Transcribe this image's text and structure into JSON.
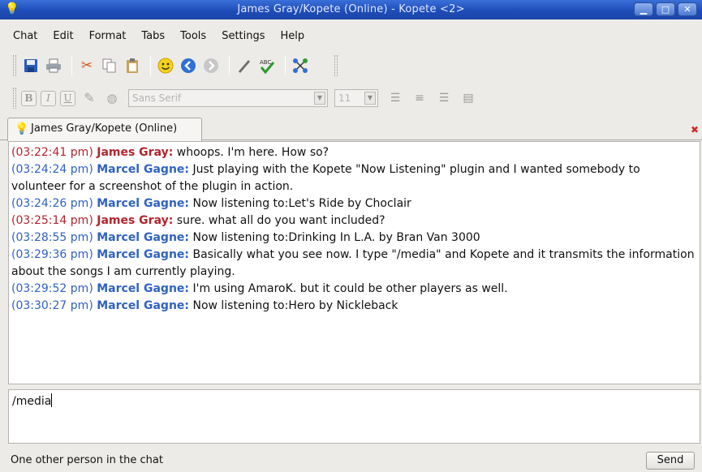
{
  "window": {
    "title": "James Gray/Kopete (Online) - Kopete <2>",
    "app_icon": "lightbulb-icon",
    "controls": [
      "minimize-icon",
      "maximize-icon",
      "close-icon"
    ]
  },
  "menu": [
    "Chat",
    "Edit",
    "Format",
    "Tabs",
    "Tools",
    "Settings",
    "Help"
  ],
  "toolbar": {
    "icons": [
      "save-icon",
      "print-icon",
      "cut-icon",
      "copy-icon",
      "paste-icon",
      "smiley-icon",
      "back-icon",
      "forward-icon",
      "pencil-icon",
      "spellcheck-icon",
      "contacts-icon"
    ]
  },
  "format_toolbar": {
    "bold": "B",
    "italic": "I",
    "underline": "U",
    "font": "Sans Serif",
    "size": "11"
  },
  "tab": {
    "label": "James Gray/Kopete (Online)"
  },
  "messages": [
    {
      "ts": "(03:22:41 pm)",
      "nick": "James Gray:",
      "text": "whoops. I'm here.  How so?",
      "sender": "them"
    },
    {
      "ts": "(03:24:24 pm)",
      "nick": "Marcel Gagne:",
      "text": "Just playing with the Kopete \"Now Listening\" plugin and I wanted somebody to volunteer for a screenshot of the plugin in action.",
      "sender": "me"
    },
    {
      "ts": "(03:24:26 pm)",
      "nick": "Marcel Gagne:",
      "text": "Now listening to:Let's Ride by Choclair",
      "sender": "me"
    },
    {
      "ts": "(03:25:14 pm)",
      "nick": "James Gray:",
      "text": "sure. what all do you want included?",
      "sender": "them"
    },
    {
      "ts": "(03:28:55 pm)",
      "nick": "Marcel Gagne:",
      "text": "Now listening to:Drinking In L.A. by Bran Van 3000",
      "sender": "me"
    },
    {
      "ts": "(03:29:36 pm)",
      "nick": "Marcel Gagne:",
      "text": "Basically what you see now. I type \"/media\" and Kopete and it transmits the information about the songs I am currently playing.",
      "sender": "me"
    },
    {
      "ts": "(03:29:52 pm)",
      "nick": "Marcel Gagne:",
      "text": "I'm using AmaroK. but it could be other players as well.",
      "sender": "me"
    },
    {
      "ts": "(03:30:27 pm)",
      "nick": "Marcel Gagne:",
      "text": "Now listening to:Hero by Nickleback",
      "sender": "me"
    }
  ],
  "input": {
    "value": "/media"
  },
  "status": {
    "text": "One other person in the chat"
  },
  "send_label": "Send"
}
